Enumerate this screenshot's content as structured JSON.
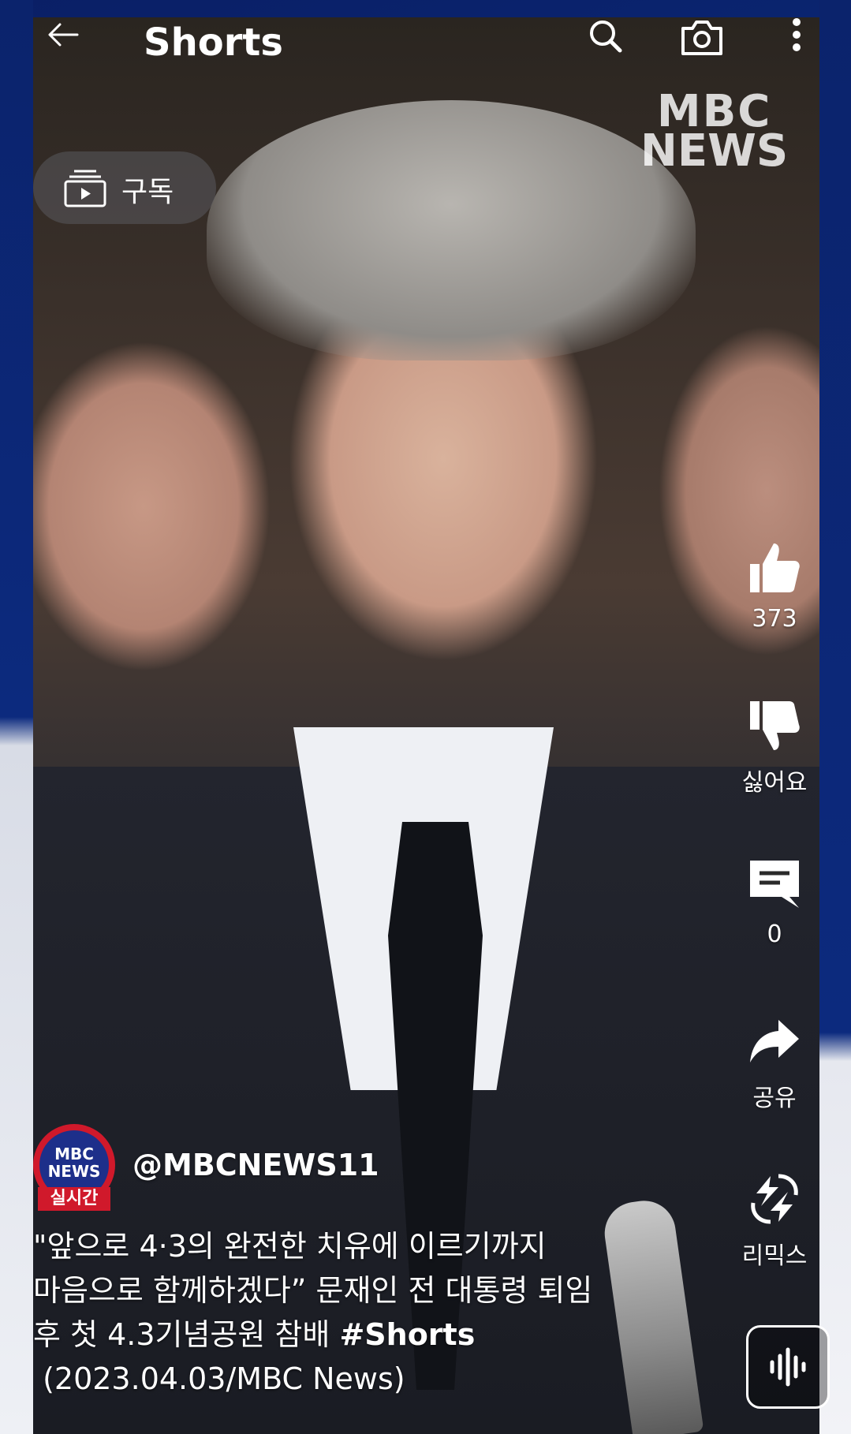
{
  "header": {
    "title": "Shorts",
    "back_icon": "arrow-left-icon",
    "search_icon": "search-icon",
    "camera_icon": "camera-icon",
    "more_icon": "more-vertical-icon"
  },
  "video": {
    "watermark_line1": "MBC",
    "watermark_line2": "NEWS"
  },
  "subscribe": {
    "label": "구독",
    "icon": "subscriptions-icon"
  },
  "actions": {
    "like": {
      "icon": "thumb-up-icon",
      "count": "373"
    },
    "dislike": {
      "icon": "thumb-down-icon",
      "label": "싫어요"
    },
    "comments": {
      "icon": "comment-icon",
      "count": "0"
    },
    "share": {
      "icon": "share-icon",
      "label": "공유"
    },
    "remix": {
      "icon": "remix-icon",
      "label": "리믹스"
    }
  },
  "channel": {
    "handle": "@MBCNEWS11",
    "avatar_logo_line1": "MBC",
    "avatar_logo_line2": "NEWS",
    "avatar_badge": "실시간"
  },
  "caption": {
    "line1": "\"앞으로 4·3의 완전한 치유에 이르기까지",
    "line2": "마음으로 함께하겠다” 문재인 전 대통령 퇴임",
    "line3": "후 첫 4.3기념공원 참배 ",
    "hashtag": "#Shorts",
    "line4": " (2023.04.03/MBC News)"
  },
  "sound": {
    "icon": "sound-wave-icon"
  },
  "colors": {
    "frame": "#0b2a7a",
    "avatar_red": "#d0192b",
    "avatar_blue": "#1d2f8a"
  }
}
